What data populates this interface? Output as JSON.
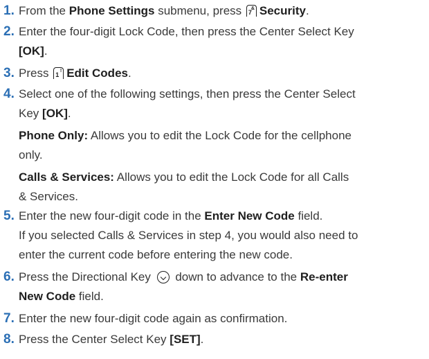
{
  "steps": [
    {
      "num": "1.",
      "a": "From the ",
      "b": "Phone Settings",
      "c": " submenu, press ",
      "key": {
        "icon": "key-7-icon",
        "digit": "7",
        "sup": "&"
      },
      "d": "Security",
      "e": "."
    },
    {
      "num": "2.",
      "l1": "Enter the four-digit Lock Code, then press the Center Select Key",
      "l2b": "[OK]",
      "l2c": "."
    },
    {
      "num": "3.",
      "a": "Press ",
      "key": {
        "icon": "key-1-icon",
        "digit": "1",
        "sup": "!"
      },
      "d": "Edit Codes",
      "e": "."
    },
    {
      "num": "4.",
      "l1": "Select one of the following settings, then press the Center Select",
      "l2a": "Key ",
      "l2b": "[OK]",
      "l2c": ".",
      "opt1_label": "Phone Only:",
      "opt1_l1": " Allows you to edit the Lock Code for the cellphone",
      "opt1_l2": "only.",
      "opt2_label": "Calls & Services:",
      "opt2_l1": " Allows you to edit the Lock Code for all Calls",
      "opt2_l2": "& Services."
    },
    {
      "num": "5.",
      "l1a": "Enter the new four-digit code in the ",
      "l1b": "Enter New Code",
      "l1c": " field.",
      "l2": "If you selected Calls & Services in step 4, you would also need to",
      "l3": "enter the current code before entering the new code."
    },
    {
      "num": "6.",
      "l1a": "Press the Directional Key ",
      "nav_icon": "directional-key-down-icon",
      "l1b": " down to advance to the ",
      "l1c": "Re-enter",
      "l2b": "New Code",
      "l2c": " field."
    },
    {
      "num": "7.",
      "l1": "Enter the new four-digit code again as confirmation."
    },
    {
      "num": "8.",
      "l1a": "Press the Center Select Key ",
      "l1b": "[SET]",
      "l1c": "."
    }
  ]
}
